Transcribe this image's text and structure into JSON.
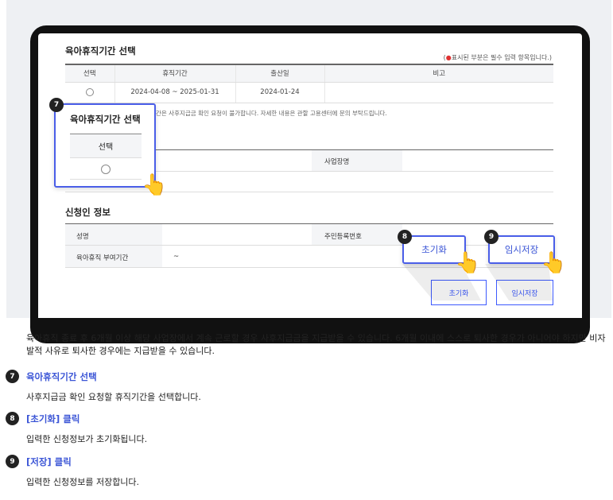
{
  "screen": {
    "period_section_title": "육아휴직기간 선택",
    "required_note_dot": "●",
    "required_note": "표시된 부분은 필수 입력 항목입니다.",
    "required_note_open": "(",
    "required_note_close": ")",
    "period_table": {
      "headers": [
        "선택",
        "휴직기간",
        "출산일",
        "비고"
      ],
      "row": {
        "period": "2024-04-08 ~ 2025-01-31",
        "birth_date": "2024-01-24",
        "remark": ""
      }
    },
    "info_note": "간은 사후지급금 확인 요청이 불가합니다. 자세한 내용은 관할 고용센터에 문의 부탁드립니다.",
    "company_label": "사업장명",
    "applicant_section_title": "신청인 정보",
    "applicant": {
      "name_label": "성명",
      "rrn_label": "주민등록번호",
      "leave_granted_label": "육아휴직 부여기간",
      "leave_granted_value": "~"
    },
    "reset_button": "초기화",
    "temp_save_button": "임시저장"
  },
  "callouts": {
    "c7": {
      "badge": "7",
      "title": "육아휴직기간 선택",
      "column": "선택"
    },
    "c8": {
      "badge": "8",
      "label": "초기화"
    },
    "c9": {
      "badge": "9",
      "label": "임시저장"
    }
  },
  "description": "육아휴직 종료 후 6개월 이상 해당 사업장에서 계속 근로할 경우 사후지급금을 지급받을 수 있습니다. 6개월 이내에 스스로 퇴사한 경우가 아니어야 하지만 비자발적 사유로 퇴사한 경우에는 지급받을 수 있습니다.",
  "steps": [
    {
      "num": "7",
      "title": "육아휴직기간 선택",
      "text": "사후지급금 확인 요청할 휴직기간을 선택합니다."
    },
    {
      "num": "8",
      "title": "[초기화] 클릭",
      "text": "입력한 신청정보가 초기화됩니다."
    },
    {
      "num": "9",
      "title": "[저장] 클릭",
      "text": "입력한 신청정보를 저장합니다."
    }
  ],
  "colors": {
    "accent": "#3b55d6",
    "badge": "#222222",
    "panel": "#eef0f3"
  }
}
